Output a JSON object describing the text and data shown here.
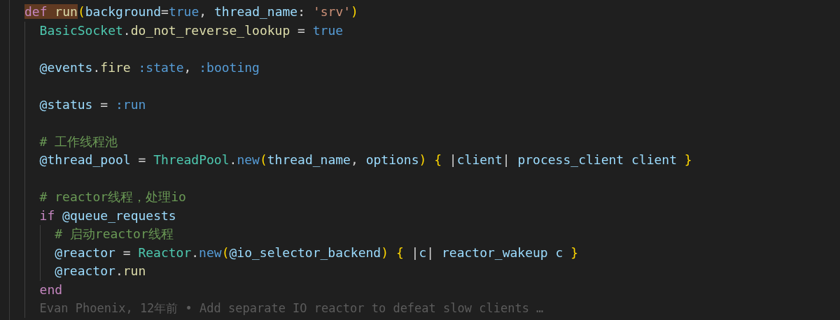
{
  "editor": {
    "lines": [
      {
        "kind": "code",
        "tokens": [
          {
            "text": "def ",
            "kind": "keyword",
            "highlighted": true
          },
          {
            "text": "run",
            "kind": "function",
            "highlighted": true
          },
          {
            "text": "(",
            "kind": "brace"
          },
          {
            "text": "background",
            "kind": "variable"
          },
          {
            "text": "=",
            "kind": "punct"
          },
          {
            "text": "true",
            "kind": "constant"
          },
          {
            "text": ", ",
            "kind": "punct"
          },
          {
            "text": "thread_name",
            "kind": "variable"
          },
          {
            "text": ": ",
            "kind": "punct"
          },
          {
            "text": "'srv'",
            "kind": "string"
          },
          {
            "text": ")",
            "kind": "brace"
          }
        ],
        "children": [
          {
            "kind": "code",
            "tokens": [
              {
                "text": "BasicSocket",
                "kind": "class"
              },
              {
                "text": ".",
                "kind": "punct"
              },
              {
                "text": "do_not_reverse_lookup",
                "kind": "function"
              },
              {
                "text": " = ",
                "kind": "punct"
              },
              {
                "text": "true",
                "kind": "constant"
              }
            ]
          },
          {
            "kind": "blank"
          },
          {
            "kind": "code",
            "tokens": [
              {
                "text": "@events",
                "kind": "variable"
              },
              {
                "text": ".",
                "kind": "punct"
              },
              {
                "text": "fire",
                "kind": "function"
              },
              {
                "text": " :state",
                "kind": "symbol"
              },
              {
                "text": ", ",
                "kind": "punct"
              },
              {
                "text": ":booting",
                "kind": "symbol"
              }
            ]
          },
          {
            "kind": "blank"
          },
          {
            "kind": "code",
            "tokens": [
              {
                "text": "@status",
                "kind": "variable"
              },
              {
                "text": " = ",
                "kind": "punct"
              },
              {
                "text": ":run",
                "kind": "symbol"
              }
            ]
          },
          {
            "kind": "blank"
          },
          {
            "kind": "code",
            "tokens": [
              {
                "text": "# 工作线程池",
                "kind": "comment"
              }
            ]
          },
          {
            "kind": "code",
            "tokens": [
              {
                "text": "@thread_pool",
                "kind": "variable"
              },
              {
                "text": " = ",
                "kind": "punct"
              },
              {
                "text": "ThreadPool",
                "kind": "class"
              },
              {
                "text": ".",
                "kind": "punct"
              },
              {
                "text": "new",
                "kind": "constant"
              },
              {
                "text": "(",
                "kind": "brace"
              },
              {
                "text": "thread_name",
                "kind": "variable"
              },
              {
                "text": ", ",
                "kind": "punct"
              },
              {
                "text": "options",
                "kind": "variable"
              },
              {
                "text": ")",
                "kind": "brace"
              },
              {
                "text": " {",
                "kind": "brace"
              },
              {
                "text": " |",
                "kind": "punct"
              },
              {
                "text": "client",
                "kind": "variable"
              },
              {
                "text": "| ",
                "kind": "punct"
              },
              {
                "text": "process_client",
                "kind": "variable"
              },
              {
                "text": " client",
                "kind": "variable"
              },
              {
                "text": " }",
                "kind": "brace"
              }
            ]
          },
          {
            "kind": "blank"
          },
          {
            "kind": "code",
            "tokens": [
              {
                "text": "# reactor线程，处理io",
                "kind": "comment"
              }
            ]
          },
          {
            "kind": "code",
            "tokens": [
              {
                "text": "if ",
                "kind": "keyword"
              },
              {
                "text": "@queue_requests",
                "kind": "variable"
              }
            ],
            "children": [
              {
                "kind": "code",
                "tokens": [
                  {
                    "text": "# 启动reactor线程",
                    "kind": "comment"
                  }
                ]
              },
              {
                "kind": "code",
                "tokens": [
                  {
                    "text": "@reactor",
                    "kind": "variable"
                  },
                  {
                    "text": " = ",
                    "kind": "punct"
                  },
                  {
                    "text": "Reactor",
                    "kind": "class"
                  },
                  {
                    "text": ".",
                    "kind": "punct"
                  },
                  {
                    "text": "new",
                    "kind": "constant"
                  },
                  {
                    "text": "(",
                    "kind": "brace"
                  },
                  {
                    "text": "@io_selector_backend",
                    "kind": "variable"
                  },
                  {
                    "text": ")",
                    "kind": "brace"
                  },
                  {
                    "text": " {",
                    "kind": "brace"
                  },
                  {
                    "text": " |",
                    "kind": "punct"
                  },
                  {
                    "text": "c",
                    "kind": "variable"
                  },
                  {
                    "text": "| ",
                    "kind": "punct"
                  },
                  {
                    "text": "reactor_wakeup",
                    "kind": "variable"
                  },
                  {
                    "text": " c",
                    "kind": "variable"
                  },
                  {
                    "text": " }",
                    "kind": "brace"
                  }
                ]
              },
              {
                "kind": "code",
                "tokens": [
                  {
                    "text": "@reactor",
                    "kind": "variable"
                  },
                  {
                    "text": ".",
                    "kind": "punct"
                  },
                  {
                    "text": "run",
                    "kind": "function"
                  }
                ]
              }
            ]
          },
          {
            "kind": "code",
            "tokens": [
              {
                "text": "end",
                "kind": "keyword"
              }
            ]
          },
          {
            "kind": "blame",
            "tokens": [
              {
                "text": "Evan Phoenix, 12年前 • Add separate IO reactor to defeat slow clients …",
                "kind": "blame"
              }
            ]
          }
        ]
      }
    ]
  }
}
